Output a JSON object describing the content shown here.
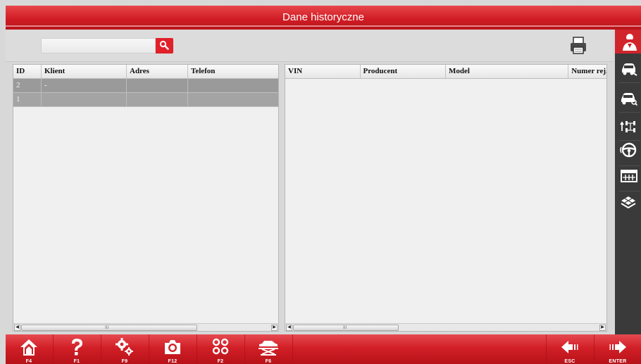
{
  "window": {
    "title": "Dane historyczne"
  },
  "toolbar": {
    "search_value": "",
    "search_placeholder": ""
  },
  "clients_table": {
    "columns": [
      "ID",
      "Klient",
      "Adres",
      "Telefon"
    ],
    "rows": [
      {
        "id": "2",
        "klient": "-",
        "adres": "",
        "telefon": ""
      },
      {
        "id": "1",
        "klient": "",
        "adres": "",
        "telefon": ""
      }
    ],
    "scroll_grip": "III"
  },
  "vehicles_table": {
    "columns": [
      "VIN",
      "Producent",
      "Model",
      "Numer rej."
    ],
    "rows": [],
    "scroll_grip": "III"
  },
  "sidebar": {
    "items": [
      {
        "icon": "client-icon",
        "active": true
      },
      {
        "icon": "car-edit-icon",
        "active": false
      },
      {
        "icon": "car-search-icon",
        "active": false
      },
      {
        "icon": "axle-icon",
        "active": false
      },
      {
        "icon": "steering-wheel-icon",
        "active": false
      },
      {
        "icon": "table-icon",
        "active": false
      },
      {
        "icon": "map-icon",
        "active": false
      }
    ]
  },
  "function_keys": {
    "home": "F4",
    "help": "F1",
    "settings": "F9",
    "camera": "F12",
    "modules": "F2",
    "lift": "F6",
    "back": "ESC",
    "next": "ENTER"
  },
  "colors": {
    "accent": "#d11d25",
    "sidebar": "#3a3a3a",
    "selected_row": "#9a9a9a"
  }
}
